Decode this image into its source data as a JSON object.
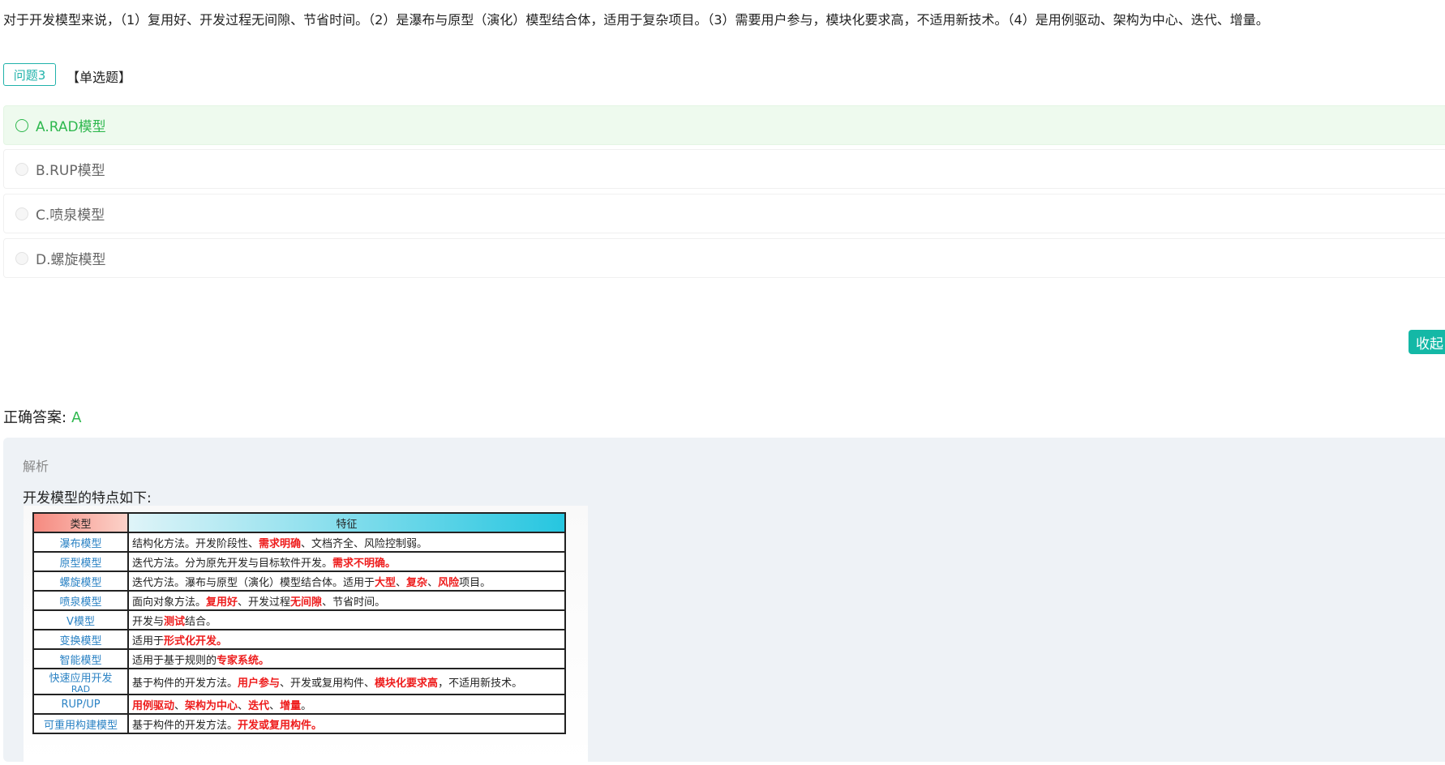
{
  "question": {
    "text": "对于开发模型来说，（1）复用好、开发过程无间隙、节省时间。（2）是瀑布与原型（演化）模型结合体，适用于复杂项目。（3）需要用户参与，模块化要求高，不适用新技术。（4）是用例驱动、架构为中心、迭代、增量。",
    "tag": "问题3",
    "type": "【单选题】"
  },
  "options": [
    {
      "label": "A.RAD模型",
      "selected": true
    },
    {
      "label": "B.RUP模型",
      "selected": false
    },
    {
      "label": "C.喷泉模型",
      "selected": false
    },
    {
      "label": "D.螺旋模型",
      "selected": false
    }
  ],
  "collapse_label": "收起",
  "answer": {
    "label": "正确答案:",
    "value": "A"
  },
  "analysis": {
    "title": "解析",
    "intro": "开发模型的特点如下:",
    "table": {
      "headers": [
        "类型",
        "特征"
      ],
      "rows": [
        {
          "type": "瀑布模型",
          "type_sub": "",
          "parts": [
            [
              "结构化方法。开发阶段性、",
              false
            ],
            [
              "需求明确",
              true
            ],
            [
              "、文档齐全、风险控制弱。",
              false
            ]
          ]
        },
        {
          "type": "原型模型",
          "type_sub": "",
          "parts": [
            [
              "迭代方法。分为原先开发与目标软件开发。",
              false
            ],
            [
              "需求不明确。",
              true
            ]
          ]
        },
        {
          "type": "螺旋模型",
          "type_sub": "",
          "parts": [
            [
              "迭代方法。瀑布与原型（演化）模型结合体。适用于",
              false
            ],
            [
              "大型",
              true
            ],
            [
              "、",
              false
            ],
            [
              "复杂",
              true
            ],
            [
              "、",
              false
            ],
            [
              "风险",
              true
            ],
            [
              "项目。",
              false
            ]
          ]
        },
        {
          "type": "喷泉模型",
          "type_sub": "",
          "parts": [
            [
              "面向对象方法。",
              false
            ],
            [
              "复用好",
              true
            ],
            [
              "、开发过程",
              false
            ],
            [
              "无间隙",
              true
            ],
            [
              "、节省时间。",
              false
            ]
          ]
        },
        {
          "type": "V模型",
          "type_sub": "",
          "parts": [
            [
              "开发与",
              false
            ],
            [
              "测试",
              true
            ],
            [
              "结合。",
              false
            ]
          ]
        },
        {
          "type": "变换模型",
          "type_sub": "",
          "parts": [
            [
              "适用于",
              false
            ],
            [
              "形式化开发。",
              true
            ]
          ]
        },
        {
          "type": "智能模型",
          "type_sub": "",
          "parts": [
            [
              "适用于基于规则的",
              false
            ],
            [
              "专家系统。",
              true
            ]
          ]
        },
        {
          "type": "快速应用开发",
          "type_sub": "RAD",
          "parts": [
            [
              "基于构件的开发方法。",
              false
            ],
            [
              "用户参与",
              true
            ],
            [
              "、开发或复用构件、",
              false
            ],
            [
              "模块化要求高",
              true
            ],
            [
              "，不适用新技术。",
              false
            ]
          ]
        },
        {
          "type": "RUP/UP",
          "type_sub": "",
          "parts": [
            [
              "用例驱动",
              true
            ],
            [
              "、",
              false
            ],
            [
              "架构为中心",
              true
            ],
            [
              "、",
              false
            ],
            [
              "迭代",
              true
            ],
            [
              "、",
              false
            ],
            [
              "增量",
              true
            ],
            [
              "。",
              false
            ]
          ]
        },
        {
          "type": "可重用构建模型",
          "type_sub": "",
          "parts": [
            [
              "基于构件的开发方法。",
              false
            ],
            [
              "开发或复用构件。",
              true
            ]
          ]
        }
      ]
    }
  }
}
